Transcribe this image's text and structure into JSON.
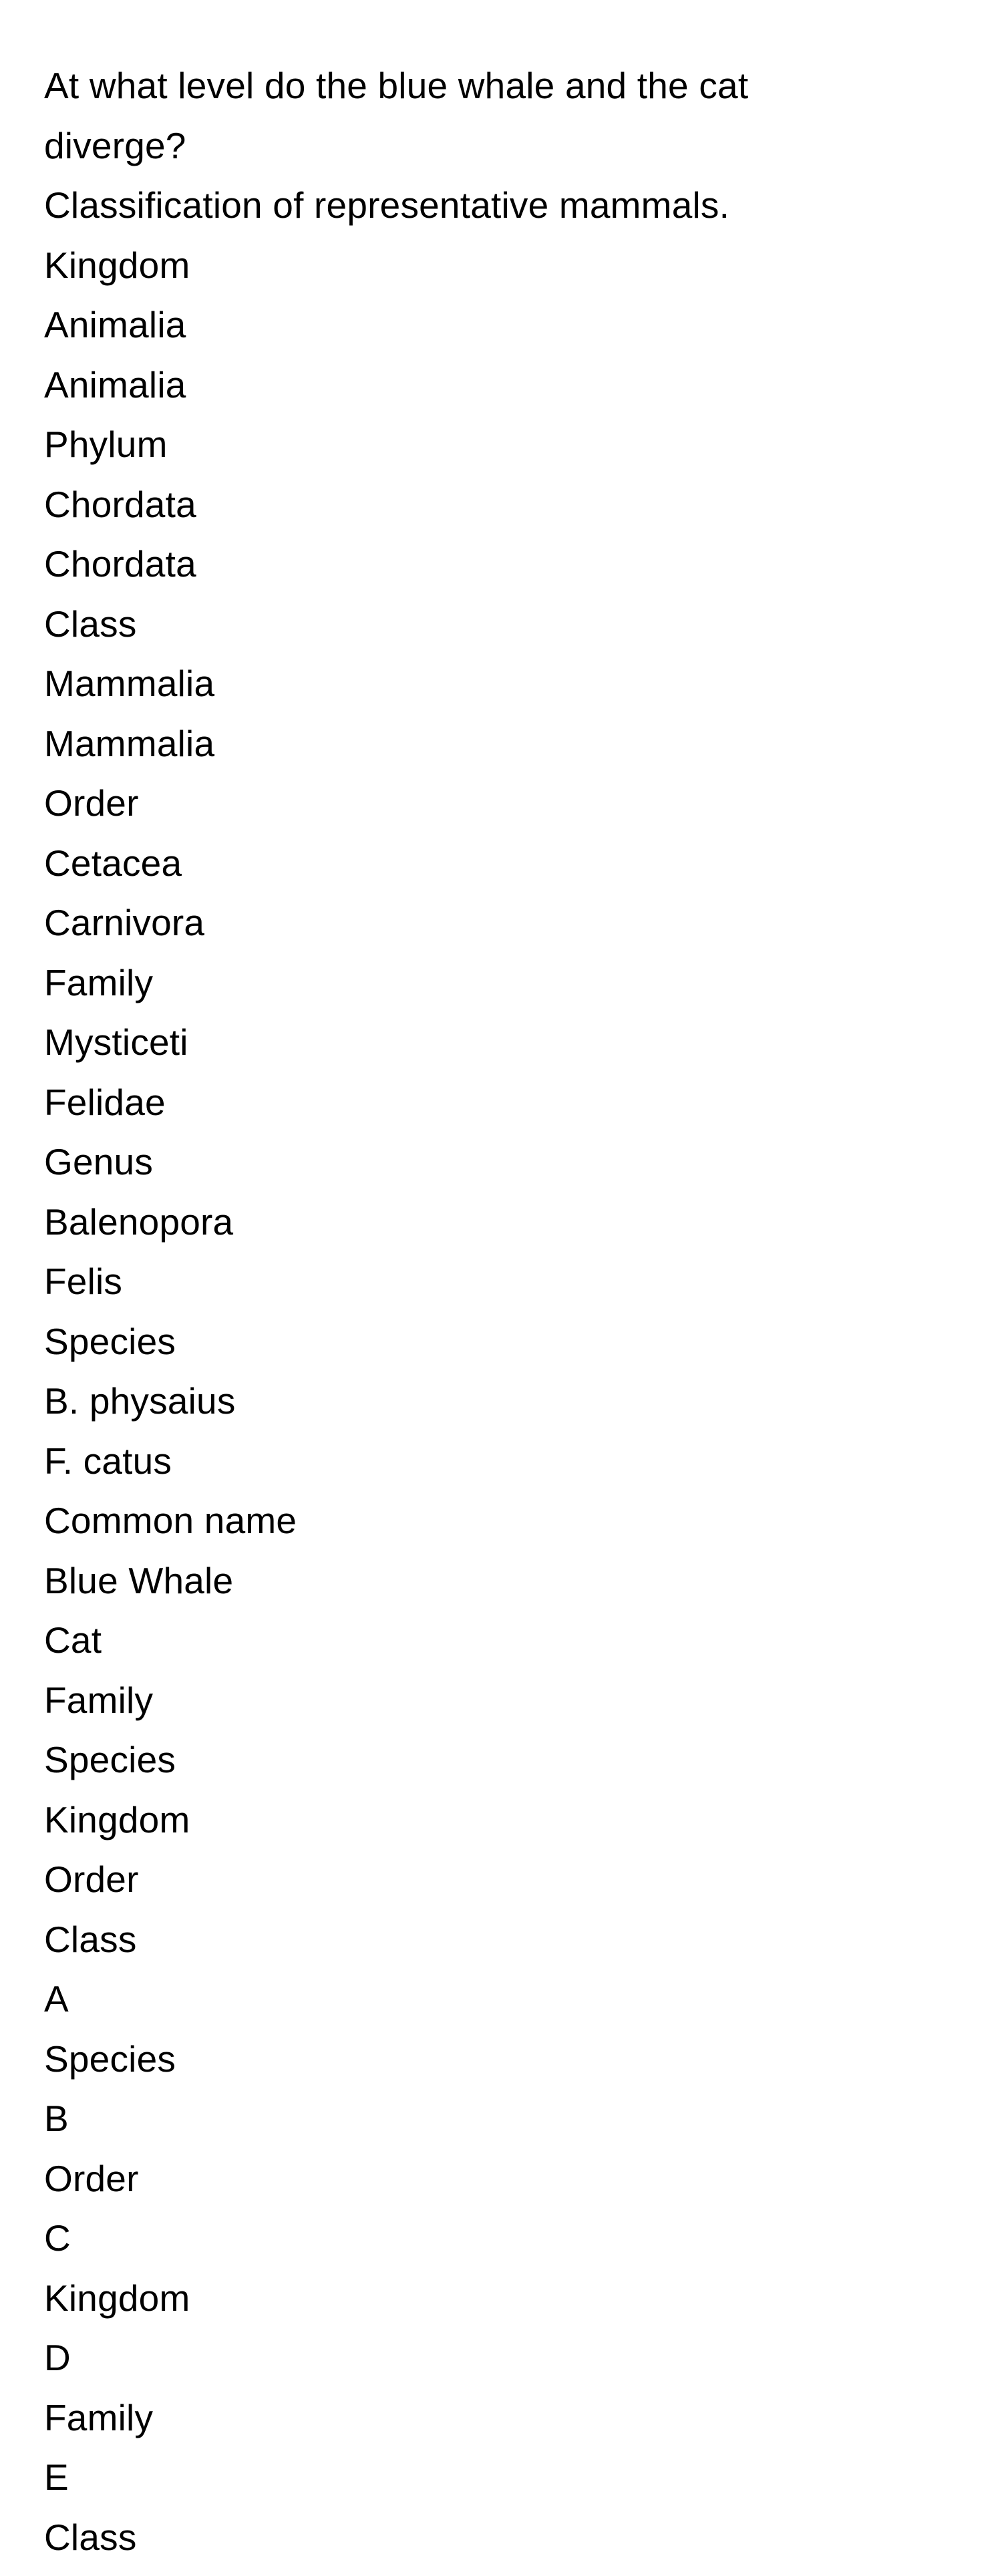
{
  "question": {
    "line1": "At what level do the blue whale and the cat",
    "line2": "diverge?"
  },
  "caption": "Classification of representative mammals.",
  "table": {
    "rows": [
      {
        "rank": "Kingdom",
        "blue_whale": "Animalia",
        "cat": "Animalia"
      },
      {
        "rank": "Phylum",
        "blue_whale": "Chordata",
        "cat": "Chordata"
      },
      {
        "rank": "Class",
        "blue_whale": "Mammalia",
        "cat": "Mammalia"
      },
      {
        "rank": "Order",
        "blue_whale": "Cetacea",
        "cat": "Carnivora"
      },
      {
        "rank": "Family",
        "blue_whale": "Mysticeti",
        "cat": "Felidae"
      },
      {
        "rank": "Genus",
        "blue_whale": "Balenopora",
        "cat": "Felis"
      },
      {
        "rank": "Species",
        "blue_whale": "B. physaius",
        "cat": "F. catus"
      },
      {
        "rank": "Common name",
        "blue_whale": "Blue Whale",
        "cat": "Cat"
      }
    ]
  },
  "word_list": [
    "Family",
    "Species",
    "Kingdom",
    "Order",
    "Class"
  ],
  "options": [
    {
      "letter": "A",
      "text": "Species"
    },
    {
      "letter": "B",
      "text": "Order"
    },
    {
      "letter": "C",
      "text": "Kingdom"
    },
    {
      "letter": "D",
      "text": "Family"
    },
    {
      "letter": "E",
      "text": "Class"
    }
  ]
}
